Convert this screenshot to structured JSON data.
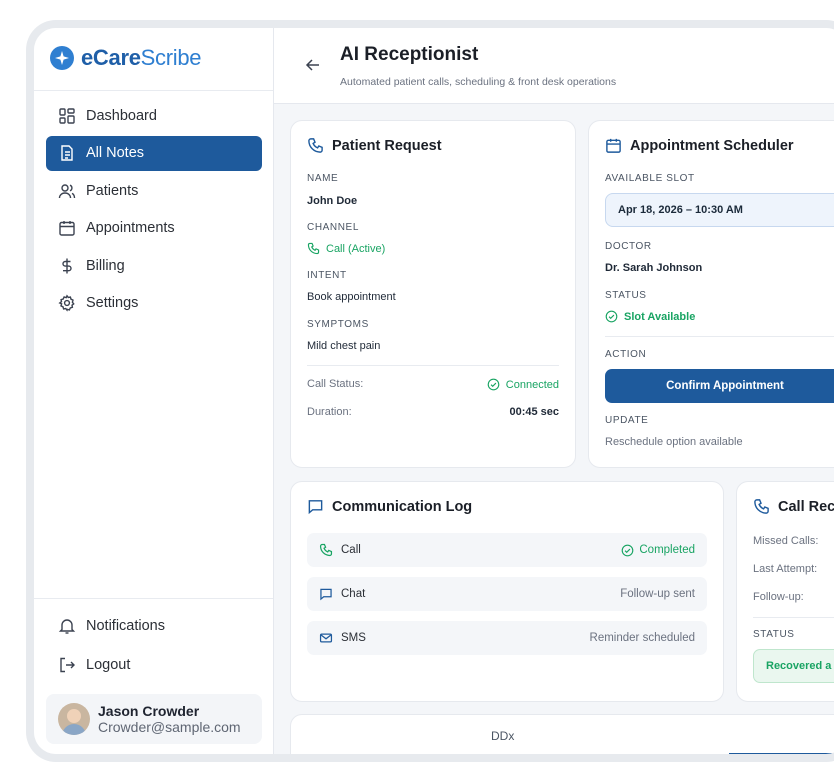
{
  "brand": {
    "name_bold": "eCare",
    "name_light": "Scribe"
  },
  "sidebar": {
    "items": [
      {
        "label": "Dashboard",
        "icon": "grid-icon"
      },
      {
        "label": "All Notes",
        "icon": "note-icon",
        "active": true
      },
      {
        "label": "Patients",
        "icon": "users-icon"
      },
      {
        "label": "Appointments",
        "icon": "calendar-icon"
      },
      {
        "label": "Billing",
        "icon": "dollar-icon"
      },
      {
        "label": "Settings",
        "icon": "gear-icon"
      }
    ],
    "bottom_items": [
      {
        "label": "Notifications",
        "icon": "bell-icon"
      },
      {
        "label": "Logout",
        "icon": "logout-icon"
      }
    ],
    "user": {
      "name": "Jason Crowder",
      "email": "Crowder@sample.com"
    }
  },
  "header": {
    "title": "AI Receptionist",
    "subtitle": "Automated patient calls, scheduling & front desk operations"
  },
  "patient_request": {
    "title": "Patient Request",
    "name_label": "NAME",
    "name": "John Doe",
    "channel_label": "CHANNEL",
    "channel": "Call (Active)",
    "intent_label": "INTENT",
    "intent": "Book appointment",
    "symptoms_label": "SYMPTOMS",
    "symptoms": "Mild chest pain",
    "call_status_label": "Call Status:",
    "call_status": "Connected",
    "duration_label": "Duration:",
    "duration": "00:45 sec"
  },
  "scheduler": {
    "title": "Appointment Scheduler",
    "slot_label": "AVAILABLE SLOT",
    "slot": "Apr 18, 2026 – 10:30 AM",
    "doctor_label": "DOCTOR",
    "doctor": "Dr. Sarah Johnson",
    "status_label": "STATUS",
    "status": "Slot Available",
    "action_label": "ACTION",
    "confirm_button": "Confirm Appointment",
    "update_label": "UPDATE",
    "update": "Reschedule option available"
  },
  "communication_log": {
    "title": "Communication Log",
    "rows": [
      {
        "channel": "Call",
        "icon": "phone-icon",
        "status": "Completed",
        "status_color": "#19a463"
      },
      {
        "channel": "Chat",
        "icon": "chat-icon",
        "status": "Follow-up sent",
        "status_color": "#6b7280"
      },
      {
        "channel": "SMS",
        "icon": "mail-icon",
        "status": "Reminder scheduled",
        "status_color": "#6b7280"
      }
    ]
  },
  "call_recovery": {
    "title": "Call Rec",
    "missed_label": "Missed Calls:",
    "last_attempt_label": "Last Attempt:",
    "followup_label": "Follow-up:",
    "status_label": "STATUS",
    "status": "Recovered a"
  },
  "tabs": {
    "ddx": "DDx"
  },
  "colors": {
    "primary": "#1e5a9c",
    "success": "#19a463",
    "brand": "#2f7fd1"
  }
}
